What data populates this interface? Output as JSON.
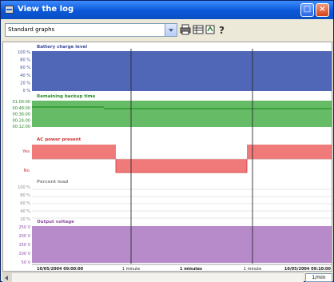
{
  "window": {
    "title": "View the log"
  },
  "toolbar": {
    "view_selected": "Standard graphs"
  },
  "graph": {
    "colors": {
      "battery": "#5067b8",
      "backup": "#66bb66",
      "backup_bar": "#2e9a2e",
      "ac_fill": "#f07a7a",
      "ac_line": "#cc3333",
      "output": "#b78bc9",
      "grid": "#d0d0d0",
      "label_blue": "#3b4d9a",
      "label_green": "#2b8a2b",
      "label_red": "#cc3333",
      "label_gray": "#8a8a8a",
      "label_purple": "#8d4fa4"
    },
    "panels": [
      {
        "id": "battery",
        "title": "Battery charge level",
        "axis_labels": [
          "100 %",
          "80 %",
          "60 %",
          "40 %",
          "20 %",
          "0 %"
        ]
      },
      {
        "id": "backup",
        "title": "Remaining backup time",
        "axis_labels": [
          "01:00:00",
          "00:48:00",
          "00:36:00",
          "00:24:00",
          "00:12:00"
        ]
      },
      {
        "id": "ac",
        "title": "AC power present",
        "axis_labels": [
          "Yes",
          "No"
        ]
      },
      {
        "id": "load",
        "title": "Percent load",
        "axis_labels": [
          "100 %",
          "80 %",
          "60 %",
          "40 %",
          "20 %"
        ]
      },
      {
        "id": "output",
        "title": "Output voltage",
        "axis_labels": [
          "250 V",
          "200 V",
          "150 V",
          "100 V",
          "50 V"
        ]
      }
    ],
    "time_axis": {
      "left": "10/05/2004 09:00:00",
      "mid1": "1 minute",
      "mid2": "1 minutes",
      "mid3": "1 minute",
      "right": "10/05/2004 09:10:00"
    }
  },
  "status": {
    "zoom": "1/min"
  }
}
